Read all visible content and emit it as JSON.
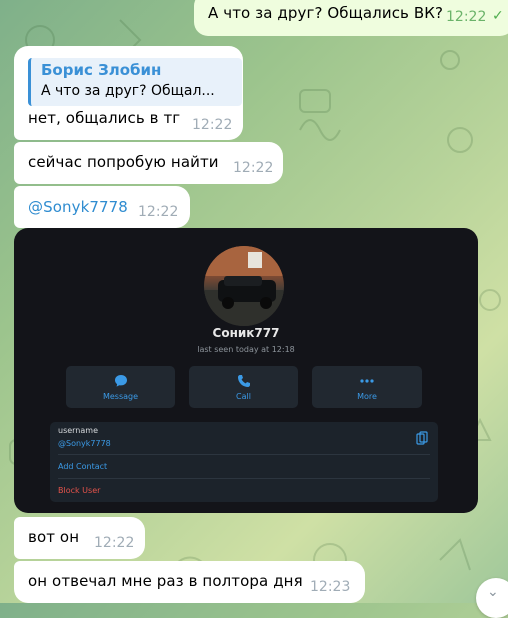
{
  "messages": {
    "out_top": {
      "text": "А что за друг? Общались ВК?",
      "time": "12:22"
    },
    "reply_msg": {
      "quote_author": "Борис Злобин",
      "quote_text": "А что за друг? Общал...",
      "text": "нет, общались в тг",
      "time": "12:22"
    },
    "msg_search": {
      "text": "сейчас попробую найти",
      "time": "12:22"
    },
    "msg_link": {
      "text": "@Sonyk7778",
      "time": "12:22"
    },
    "msg_found": {
      "text": "вот он",
      "time": "12:22"
    },
    "msg_last": {
      "text": "он отвечал мне раз в полтора дня",
      "time": "12:23"
    }
  },
  "profile_screenshot": {
    "name": "Соник777",
    "last_seen": "last seen today at 12:18",
    "actions": [
      {
        "label": "Message",
        "icon": "message-bubble-icon"
      },
      {
        "label": "Call",
        "icon": "phone-icon"
      },
      {
        "label": "More",
        "icon": "more-dots-icon"
      }
    ],
    "username_label": "username",
    "username_value": "@Sonyk7778",
    "add_contact": "Add Contact",
    "block_user": "Block User"
  },
  "colors": {
    "link": "#2f8cd0",
    "out_bubble": "#effdde",
    "danger": "#e5534b"
  }
}
